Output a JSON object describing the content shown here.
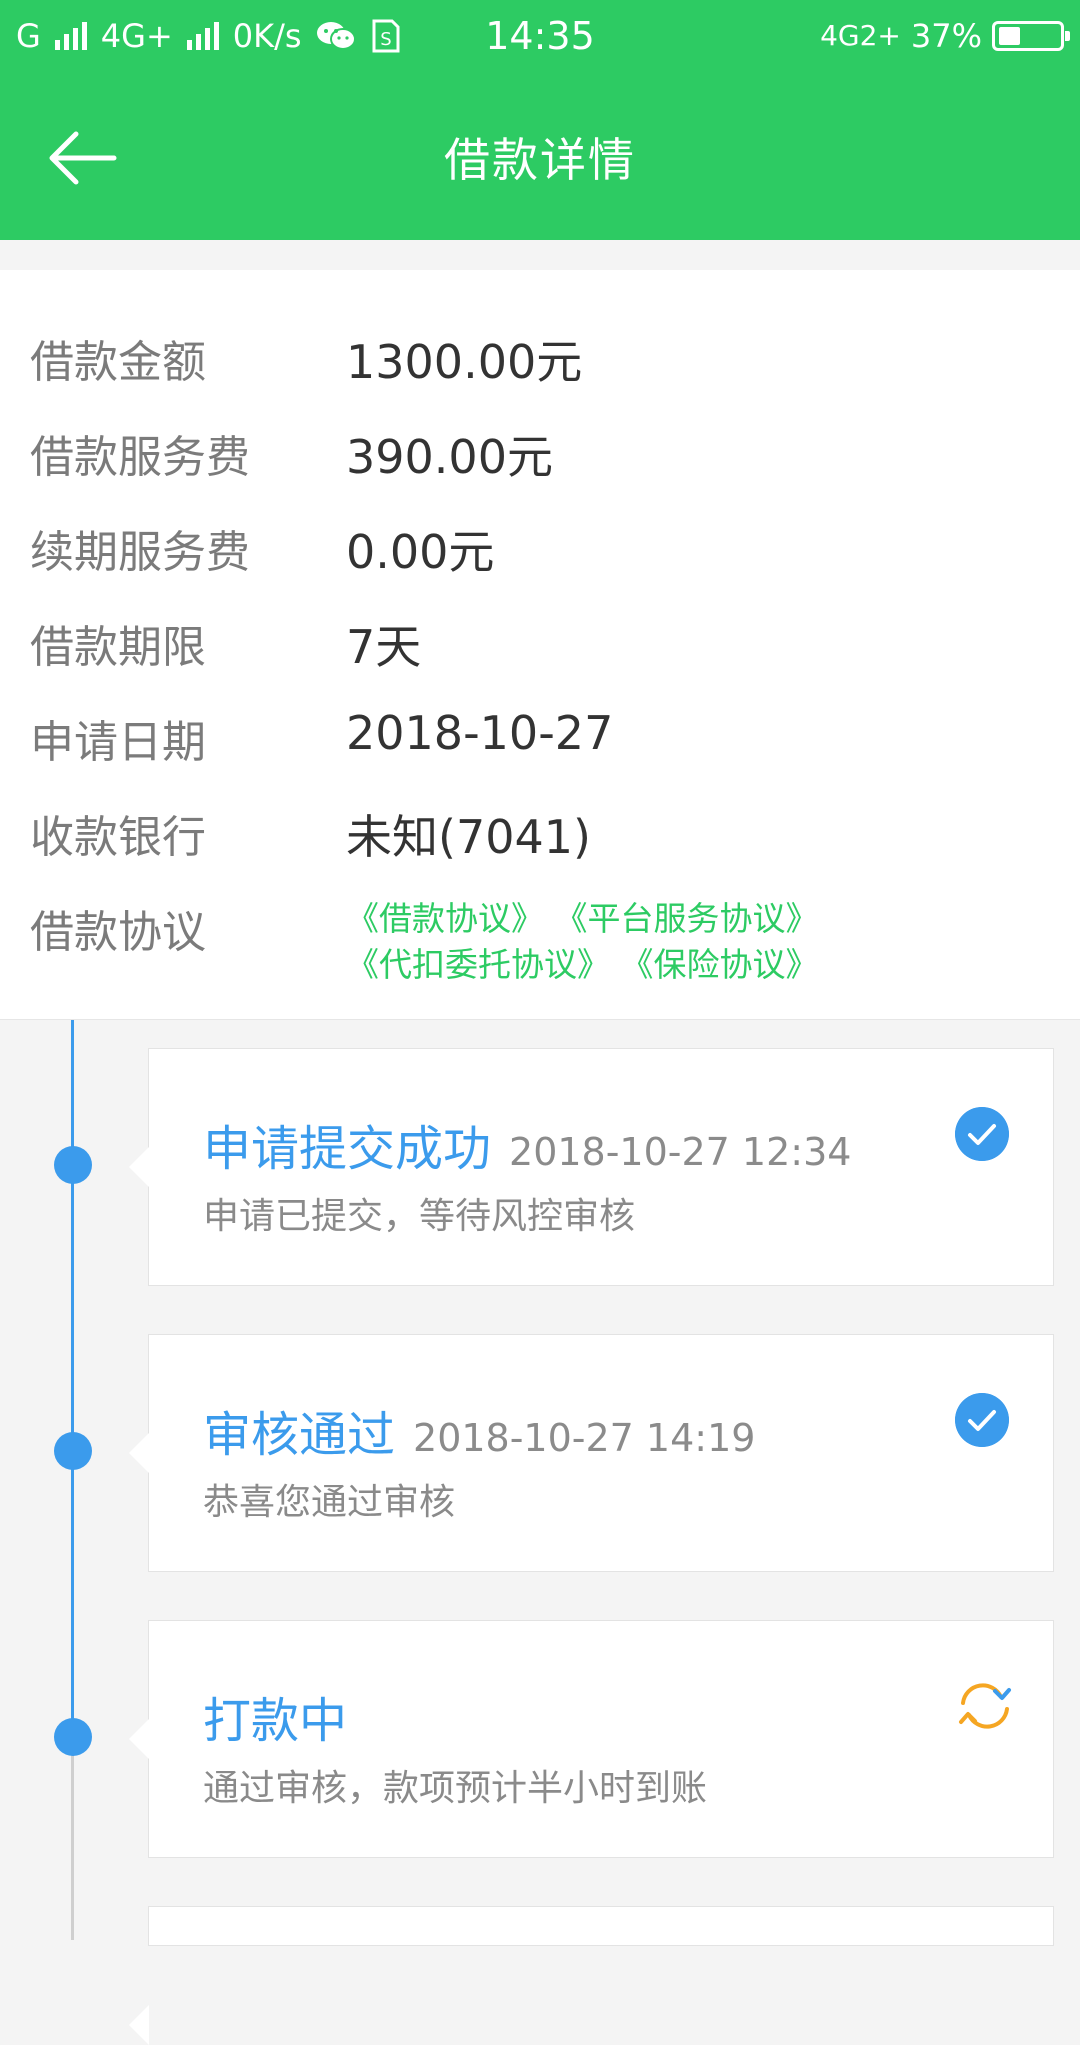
{
  "status_bar": {
    "left_text": [
      "G",
      "4G+",
      "0K/s"
    ],
    "time": "14:35",
    "network_right": "4G2+",
    "battery": "37%",
    "battery_level": 0.37,
    "icons": [
      "signal-icon",
      "wechat-icon",
      "sim-icon"
    ]
  },
  "header": {
    "title": "借款详情",
    "back_icon": "arrow-left-icon"
  },
  "loan_info": [
    {
      "label": "借款金额",
      "value": "1300.00元"
    },
    {
      "label": "借款服务费",
      "value": "390.00元"
    },
    {
      "label": "续期服务费",
      "value": "0.00元"
    },
    {
      "label": "借款期限",
      "value": "7天"
    },
    {
      "label": "申请日期",
      "value": "2018-10-27"
    },
    {
      "label": "收款银行",
      "value": "未知(7041)"
    }
  ],
  "agreements": {
    "label": "借款协议",
    "links": [
      "《借款协议》",
      "《平台服务协议》",
      "《代扣委托协议》",
      "《保险协议》"
    ]
  },
  "timeline": [
    {
      "title": "申请提交成功",
      "time": "2018-10-27 12:34",
      "desc": "申请已提交，等待风控审核",
      "status": "check-circle-icon"
    },
    {
      "title": "审核通过",
      "time": "2018-10-27 14:19",
      "desc": "恭喜您通过审核",
      "status": "check-circle-icon"
    },
    {
      "title": "打款中",
      "time": "",
      "desc": "通过审核，款项预计半小时到账",
      "status": "refresh-icon"
    }
  ],
  "colors": {
    "brand_green": "#2dcb63",
    "timeline_blue": "#3b9bec",
    "pending_orange": "#f5a623"
  }
}
